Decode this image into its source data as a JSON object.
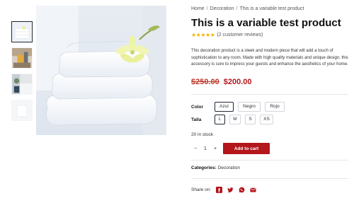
{
  "breadcrumb": {
    "items": [
      "Home",
      "Decoration",
      "This is a variable test product"
    ],
    "separator": "/"
  },
  "product": {
    "title": "This is a variable test product",
    "rating": {
      "stars": "★★★★★",
      "value": 5,
      "reviews_text": "(2 customer reviews)"
    },
    "description": "This decoration product is a sleek and modern piece that will add a touch of sophistication to any room. Made with high quality materials and unique design, this accessory is sure to impress your guests and enhance the aesthetics of your home.",
    "price": {
      "old": "$250.00",
      "new": "$200.00"
    },
    "stock": "20 in stock",
    "quantity": {
      "minus": "−",
      "value": "1",
      "plus": "+"
    },
    "add_to_cart": "Add to cart",
    "categories": {
      "label": "Categories:",
      "value": "Decoration"
    },
    "share": {
      "label": "Share on:"
    }
  },
  "attributes": {
    "color": {
      "label": "Color",
      "options": [
        "Azul",
        "Negro",
        "Rojo"
      ],
      "selected": "Azul"
    },
    "talla": {
      "label": "Talla",
      "options": [
        "L",
        "M",
        "S",
        "XS"
      ],
      "selected": "L"
    }
  },
  "gallery": {
    "thumbnails": [
      "towels-thumbnail",
      "chair-thumbnail",
      "room-thumbnail",
      "white-thumbnail"
    ],
    "active": 0
  },
  "colors": {
    "accent": "#b3161b",
    "old_price": "#c0392b",
    "star": "#f4b400",
    "divider": "#e5e7eb"
  },
  "icons": [
    "facebook-icon",
    "twitter-icon",
    "whatsapp-icon",
    "email-icon"
  ]
}
